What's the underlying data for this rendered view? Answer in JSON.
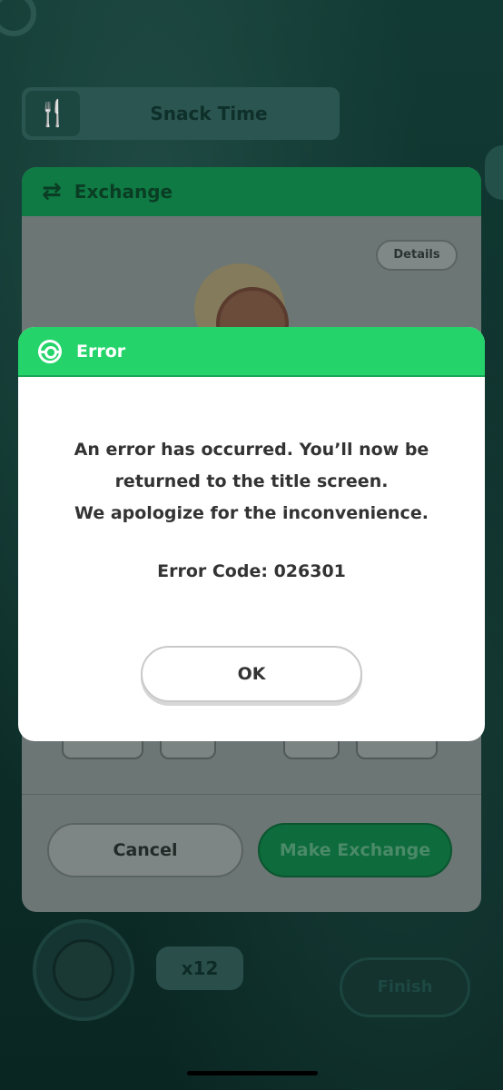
{
  "background": {
    "snack_label": "Snack Time",
    "bottom_count": "x12",
    "finish_label": "Finish"
  },
  "exchange": {
    "title": "Exchange",
    "details_label": "Details",
    "cancel_label": "Cancel",
    "make_exchange_label": "Make Exchange",
    "header_color": "#0f7a43"
  },
  "error_dialog": {
    "title": "Error",
    "message_lines": [
      "An error has occurred. You’ll now be",
      "returned to the title screen.",
      "We apologize for the inconvenience."
    ],
    "error_code": "Error Code: 026301",
    "ok_label": "OK",
    "accent_color": "#24d46a"
  }
}
